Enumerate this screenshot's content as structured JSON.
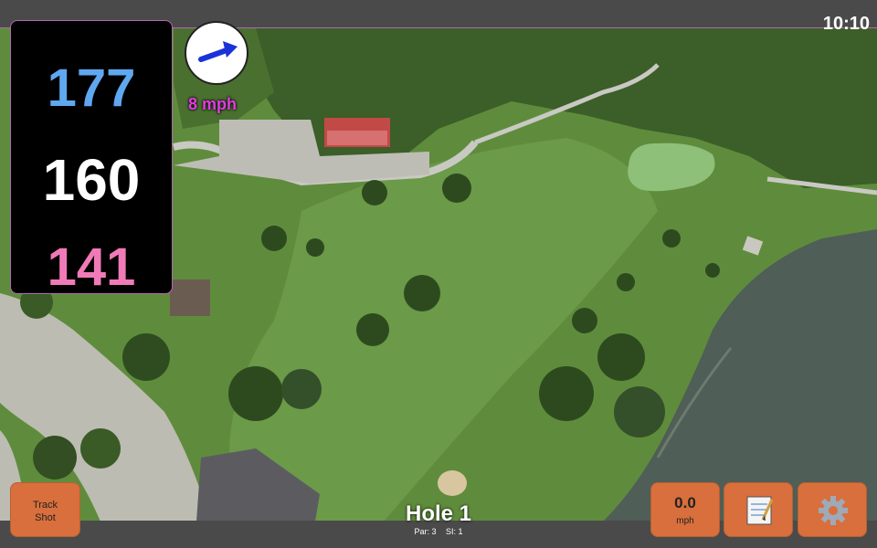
{
  "status": {
    "time": "10:10"
  },
  "distances": {
    "back": "177",
    "center": "160",
    "front": "141"
  },
  "wind": {
    "speed": "8 mph",
    "icon": "wind-arrow-icon"
  },
  "hole": {
    "title": "Hole 1",
    "par": "Par: 3",
    "si": "SI: 1"
  },
  "buttons": {
    "track_shot_line1": "Track",
    "track_shot_line2": "Shot",
    "speed_value": "0.0",
    "speed_unit": "mph",
    "notes_icon": "notepad-icon",
    "settings_icon": "gear-icon"
  },
  "colors": {
    "back": "#5fa8f0",
    "center": "#ffffff",
    "front": "#f07ab8",
    "wind_text": "#e23ce2",
    "button": "#d86f3c",
    "accent_border": "#b06ab0"
  }
}
